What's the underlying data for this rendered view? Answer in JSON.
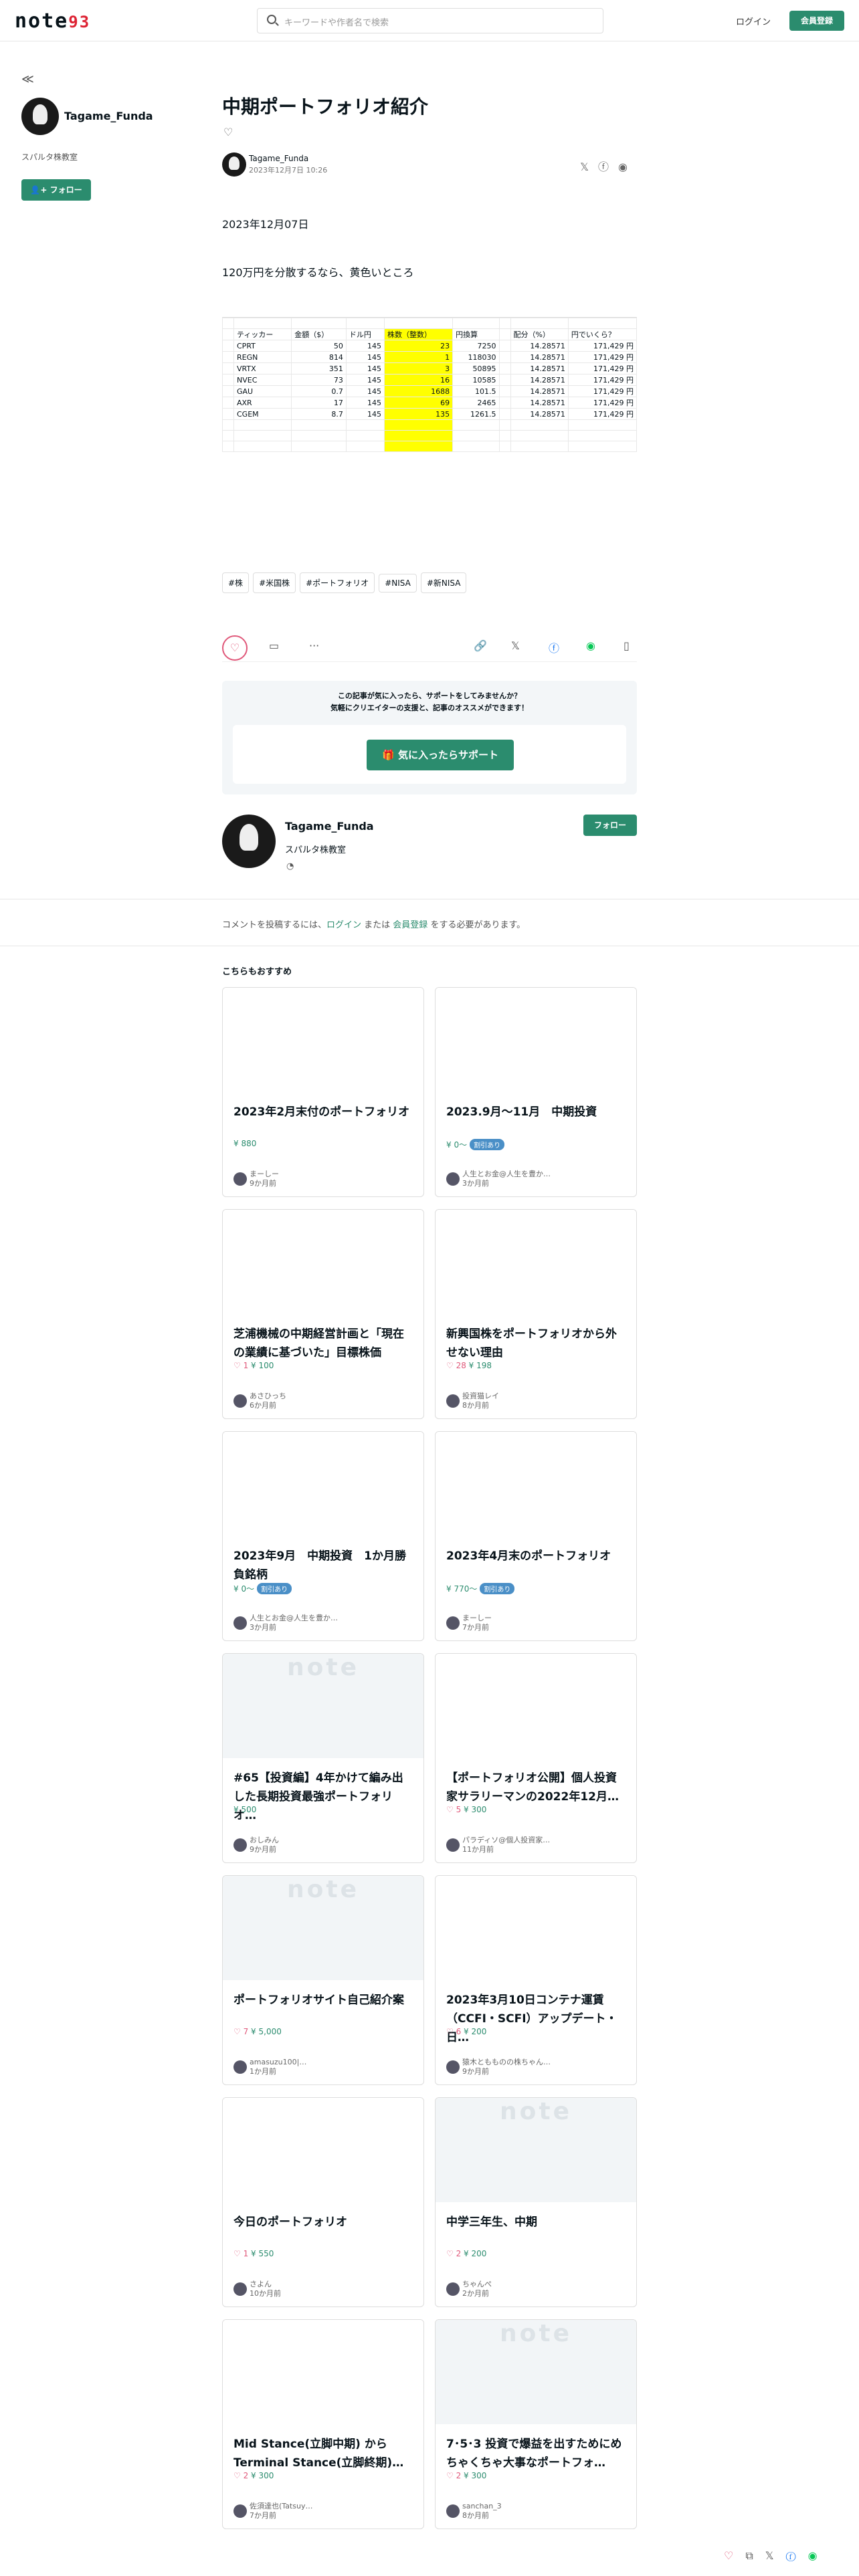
{
  "header": {
    "logo": "note",
    "logo_suffix": "93",
    "search_placeholder": "キーワードや作者名で検索",
    "login": "ログイン",
    "signup": "会員登録"
  },
  "sidebar": {
    "back": "≪",
    "username": "Tagame_Funda",
    "bio": "スパルタ株教室",
    "follow": "フォロー"
  },
  "article": {
    "title": "中期ポートフォリオ紹介",
    "author": "Tagame_Funda",
    "date": "2023年12月7日 10:26",
    "p1": "2023年12月07日",
    "p2": "120万円を分散するなら、黄色いところ",
    "table_header": [
      "ティッカー",
      "金額（$）",
      "ドル円",
      "株数（整数）",
      "円換算",
      "",
      "配分（%）",
      "円でいくら？"
    ],
    "table_rows": [
      [
        "CPRT",
        "50",
        "145",
        "23",
        "7250",
        "",
        "14.28571",
        "171,429 円"
      ],
      [
        "REGN",
        "814",
        "145",
        "1",
        "118030",
        "",
        "14.28571",
        "171,429 円"
      ],
      [
        "VRTX",
        "351",
        "145",
        "3",
        "50895",
        "",
        "14.28571",
        "171,429 円"
      ],
      [
        "NVEC",
        "73",
        "145",
        "16",
        "10585",
        "",
        "14.28571",
        "171,429 円"
      ],
      [
        "GAU",
        "0.7",
        "145",
        "1688",
        "101.5",
        "",
        "14.28571",
        "171,429 円"
      ],
      [
        "AXR",
        "17",
        "145",
        "69",
        "2465",
        "",
        "14.28571",
        "171,429 円"
      ],
      [
        "CGEM",
        "8.7",
        "145",
        "135",
        "1261.5",
        "",
        "14.28571",
        "171,429 円"
      ]
    ],
    "tags": [
      "#株",
      "#米国株",
      "#ポートフォリオ",
      "#NISA",
      "#新NISA"
    ]
  },
  "support": {
    "line1": "この記事が気に入ったら、サポートをしてみませんか？",
    "line2": "気軽にクリエイターの支援と、記事のオススメができます！",
    "button": "気に入ったらサポート"
  },
  "creator": {
    "name": "Tagame_Funda",
    "bio": "スパルタ株教室",
    "follow": "フォロー"
  },
  "comment": {
    "pre": "コメントを投稿するには、",
    "login": "ログイン",
    "mid": " または ",
    "signup": "会員登録",
    "post": " をする必要があります。"
  },
  "recommend_title": "こちらもおすすめ",
  "cards": [
    {
      "title": "2023年2月末付のポートフォリオ",
      "likes": "",
      "price": "¥ 880",
      "sale": "",
      "user": "まーしー",
      "time": "9か月前",
      "gray": false
    },
    {
      "title": "2023.9月〜11月　中期投資",
      "likes": "",
      "price": "¥ 0〜",
      "sale": "割引あり",
      "user": "人生とお金@人生を豊か…",
      "time": "3か月前",
      "gray": false
    },
    {
      "title": "芝浦機械の中期経営計画と「現在の業績に基づいた」目標株価",
      "likes": "♡ 1",
      "price": "¥ 100",
      "sale": "",
      "user": "あさひっち",
      "time": "6か月前",
      "gray": false
    },
    {
      "title": "新興国株をポートフォリオから外せない理由",
      "likes": "♡ 28",
      "price": "¥ 198",
      "sale": "",
      "user": "投資猫レイ",
      "time": "8か月前",
      "gray": false
    },
    {
      "title": "2023年9月　中期投資　1か月勝負銘柄",
      "likes": "",
      "price": "¥ 0〜",
      "sale": "割引あり",
      "user": "人生とお金@人生を豊か…",
      "time": "3か月前",
      "gray": false
    },
    {
      "title": "2023年4月末のポートフォリオ",
      "likes": "",
      "price": "¥ 770〜",
      "sale": "割引あり",
      "user": "まーしー",
      "time": "7か月前",
      "gray": false
    },
    {
      "title": "#65【投資編】4年かけて編み出した長期投資最強ポートフォリオ…",
      "likes": "",
      "price": "¥ 500",
      "sale": "",
      "user": "おしみん",
      "time": "9か月前",
      "gray": true
    },
    {
      "title": "【ポートフォリオ公開】個人投資家サラリーマンの2022年12月…",
      "likes": "♡ 5",
      "price": "¥ 300",
      "sale": "",
      "user": "パラディソ@個人投資家…",
      "time": "11か月前",
      "gray": false
    },
    {
      "title": "ポートフォリオサイト自己紹介案",
      "likes": "♡ 7",
      "price": "¥ 5,000",
      "sale": "",
      "user": "amasuzu100|…",
      "time": "1か月前",
      "gray": true
    },
    {
      "title": "2023年3月10日コンテナ運賃（CCFI・SCFI）アップデート・日…",
      "likes": "♡ 6",
      "price": "¥ 200",
      "sale": "",
      "user": "猿木ともものの株ちゃん…",
      "time": "9か月前",
      "gray": false
    },
    {
      "title": "今日のポートフォリオ",
      "likes": "♡ 1",
      "price": "¥ 550",
      "sale": "",
      "user": "さよん",
      "time": "10か月前",
      "gray": false
    },
    {
      "title": "中学三年生、中期",
      "likes": "♡ 2",
      "price": "¥ 200",
      "sale": "",
      "user": "ちゃんぺ",
      "time": "2か月前",
      "gray": true
    },
    {
      "title": "Mid Stance(立脚中期) から Terminal Stance(立脚終期)…",
      "likes": "♡ 2",
      "price": "¥ 300",
      "sale": "",
      "user": "佐須達也(Tatsuy…",
      "time": "7か月前",
      "gray": false
    },
    {
      "title": "7･5･3 投資で爆益を出すためにめちゃくちゃ大事なポートフォ…",
      "likes": "♡ 2",
      "price": "¥ 300",
      "sale": "",
      "user": "sanchan_3",
      "time": "8か月前",
      "gray": true
    }
  ]
}
